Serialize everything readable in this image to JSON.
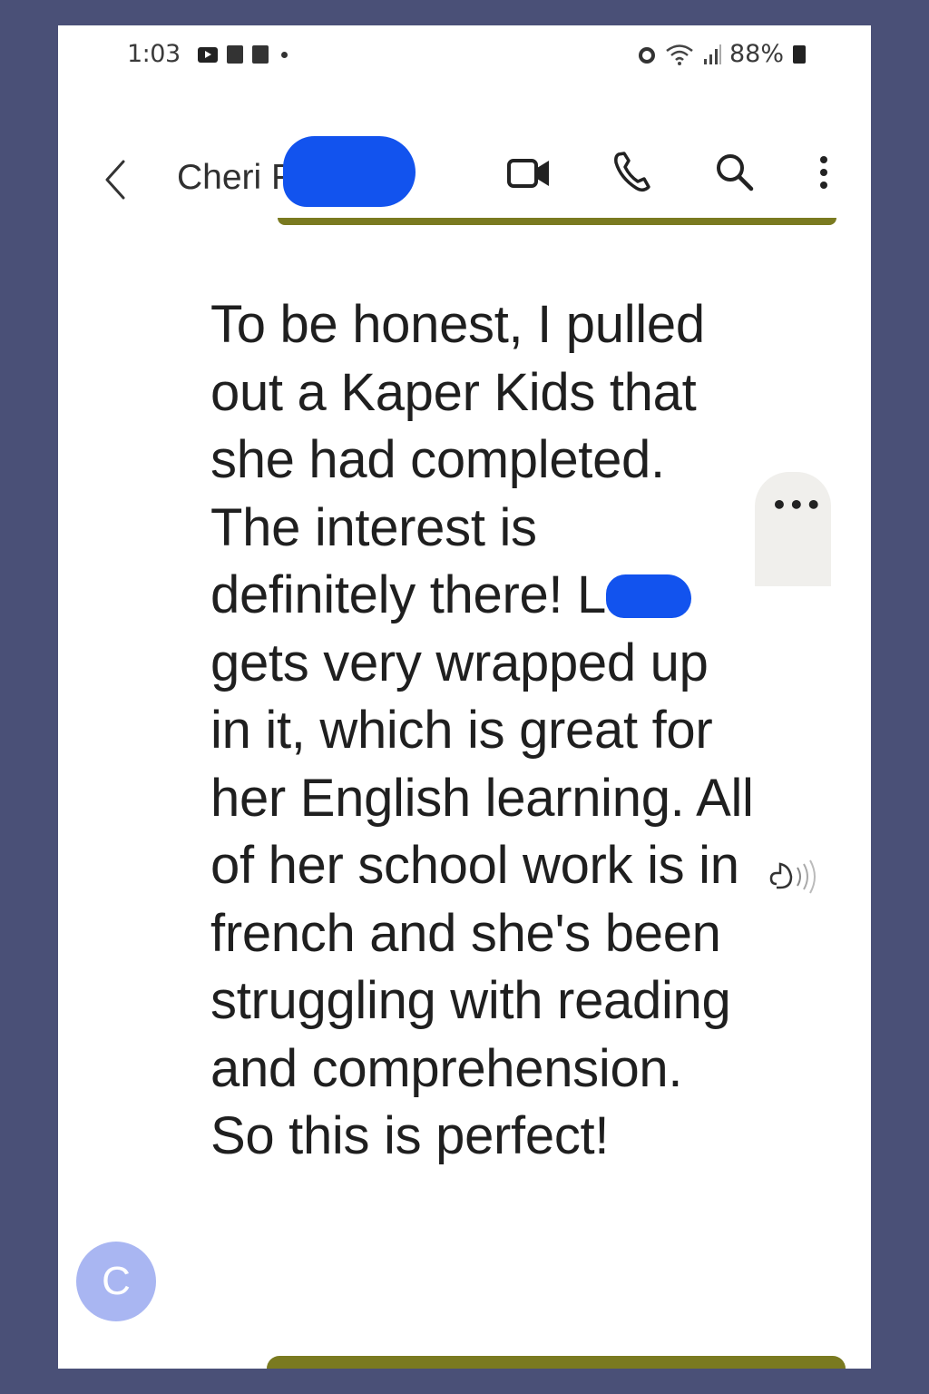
{
  "status_bar": {
    "time": "1:03",
    "battery": "88%",
    "left_icons": [
      "youtube-icon",
      "notification-icon",
      "notification-icon"
    ],
    "right_icons": [
      "alarm-icon",
      "wifi-icon",
      "signal-icon",
      "battery-icon"
    ]
  },
  "conversation": {
    "contact_name": "Cheri F",
    "actions": [
      "video-call-icon",
      "phone-call-icon",
      "search-icon",
      "more-options-icon"
    ]
  },
  "message": {
    "text_before_redaction": "To be honest, I pulled out a Kaper Kids that she had completed.  The interest is definitely there!  L",
    "text_after_redaction": " gets very wrapped up in it, which is great for her English learning.  All of her school work is in french and she's been struggling with reading and comprehension.  So this is perfect!",
    "more_options_label": "•••",
    "sender_initial": "C"
  },
  "colors": {
    "frame": "#4a5077",
    "redaction": "#1253ee",
    "divider": "#7a7a20",
    "avatar": "#a9b6f2"
  }
}
